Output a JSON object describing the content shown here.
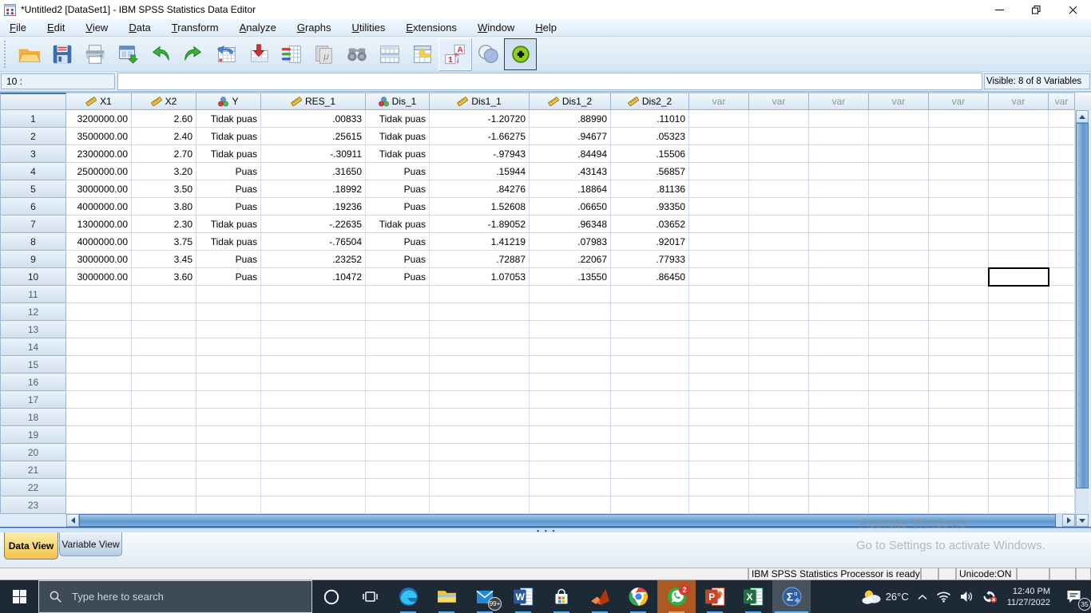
{
  "window": {
    "title": "*Untitled2 [DataSet1] - IBM SPSS Statistics Data Editor",
    "controls": {
      "minimize": "minimize",
      "restore": "restore",
      "close": "close"
    }
  },
  "menu": {
    "items": [
      {
        "label": "File",
        "underline": "F"
      },
      {
        "label": "Edit",
        "underline": "E"
      },
      {
        "label": "View",
        "underline": "V"
      },
      {
        "label": "Data",
        "underline": "D"
      },
      {
        "label": "Transform",
        "underline": "T"
      },
      {
        "label": "Analyze",
        "underline": "A"
      },
      {
        "label": "Graphs",
        "underline": "G"
      },
      {
        "label": "Utilities",
        "underline": "U"
      },
      {
        "label": "Extensions",
        "underline": "E"
      },
      {
        "label": "Window",
        "underline": "W"
      },
      {
        "label": "Help",
        "underline": "H"
      }
    ]
  },
  "toolbar": {
    "icons": [
      {
        "name": "open-data",
        "state": "normal"
      },
      {
        "name": "save",
        "state": "normal"
      },
      {
        "name": "print",
        "state": "normal"
      },
      {
        "name": "recall-dialogs",
        "state": "normal"
      },
      {
        "name": "undo",
        "state": "normal"
      },
      {
        "name": "redo",
        "state": "normal"
      },
      {
        "name": "goto-case",
        "state": "normal"
      },
      {
        "name": "goto-variable",
        "state": "normal"
      },
      {
        "name": "variables",
        "state": "normal"
      },
      {
        "name": "descriptives",
        "state": "disabled"
      },
      {
        "name": "find",
        "state": "disabled"
      },
      {
        "name": "insert-cases",
        "state": "normal"
      },
      {
        "name": "select-cases",
        "state": "normal"
      },
      {
        "name": "value-labels",
        "state": "raised"
      },
      {
        "name": "use-variable-sets",
        "state": "normal"
      },
      {
        "name": "show-all-variables",
        "state": "pressed"
      }
    ]
  },
  "cellbar": {
    "cell_reference": "10 :",
    "edit_value": "",
    "visible_info": "Visible: 8 of 8 Variables"
  },
  "grid": {
    "columns": [
      {
        "label": "X1",
        "type": "scale"
      },
      {
        "label": "X2",
        "type": "scale"
      },
      {
        "label": "Y",
        "type": "nominal"
      },
      {
        "label": "RES_1",
        "type": "scale"
      },
      {
        "label": "Dis_1",
        "type": "nominal"
      },
      {
        "label": "Dis1_1",
        "type": "scale"
      },
      {
        "label": "Dis1_2",
        "type": "scale"
      },
      {
        "label": "Dis2_2",
        "type": "scale"
      },
      {
        "label": "var",
        "type": "empty"
      },
      {
        "label": "var",
        "type": "empty"
      },
      {
        "label": "var",
        "type": "empty"
      },
      {
        "label": "var",
        "type": "empty"
      },
      {
        "label": "var",
        "type": "empty"
      },
      {
        "label": "var",
        "type": "empty"
      },
      {
        "label": "var",
        "type": "empty"
      }
    ],
    "total_rows": 23,
    "rows": [
      {
        "n": "1",
        "values": [
          "3200000.00",
          "2.60",
          "Tidak puas",
          ".00833",
          "Tidak puas",
          "-1.20720",
          ".88990",
          ".11010"
        ]
      },
      {
        "n": "2",
        "values": [
          "3500000.00",
          "2.40",
          "Tidak puas",
          ".25615",
          "Tidak puas",
          "-1.66275",
          ".94677",
          ".05323"
        ]
      },
      {
        "n": "3",
        "values": [
          "2300000.00",
          "2.70",
          "Tidak puas",
          "-.30911",
          "Tidak puas",
          "-.97943",
          ".84494",
          ".15506"
        ]
      },
      {
        "n": "4",
        "values": [
          "2500000.00",
          "3.20",
          "Puas",
          ".31650",
          "Puas",
          ".15944",
          ".43143",
          ".56857"
        ]
      },
      {
        "n": "5",
        "values": [
          "3000000.00",
          "3.50",
          "Puas",
          ".18992",
          "Puas",
          ".84276",
          ".18864",
          ".81136"
        ]
      },
      {
        "n": "6",
        "values": [
          "4000000.00",
          "3.80",
          "Puas",
          ".19236",
          "Puas",
          "1.52608",
          ".06650",
          ".93350"
        ]
      },
      {
        "n": "7",
        "values": [
          "1300000.00",
          "2.30",
          "Tidak puas",
          "-.22635",
          "Tidak puas",
          "-1.89052",
          ".96348",
          ".03652"
        ]
      },
      {
        "n": "8",
        "values": [
          "4000000.00",
          "3.75",
          "Tidak puas",
          "-.76504",
          "Puas",
          "1.41219",
          ".07983",
          ".92017"
        ]
      },
      {
        "n": "9",
        "values": [
          "3000000.00",
          "3.45",
          "Puas",
          ".23252",
          "Puas",
          ".72887",
          ".22067",
          ".77933"
        ]
      },
      {
        "n": "10",
        "values": [
          "3000000.00",
          "3.60",
          "Puas",
          ".10472",
          "Puas",
          "1.07053",
          ".13550",
          ".86450"
        ]
      }
    ],
    "selected_cell": {
      "row": 10,
      "column_index": 13
    }
  },
  "tabs": {
    "data_view": "Data View",
    "variable_view": "Variable View"
  },
  "statusbar": {
    "message": "IBM SPSS Statistics Processor is ready",
    "unicode": "Unicode:ON"
  },
  "watermark": {
    "line1": "Activate Windows",
    "line2": "Go to Settings to activate Windows."
  },
  "taskbar": {
    "search_placeholder": "Type here to search",
    "apps": [
      {
        "name": "edge"
      },
      {
        "name": "file-explorer"
      },
      {
        "name": "mail",
        "badge": "99+"
      },
      {
        "name": "word"
      },
      {
        "name": "store"
      },
      {
        "name": "matlab"
      },
      {
        "name": "chrome"
      },
      {
        "name": "whatsapp",
        "badge": "2",
        "highlight": "orange"
      },
      {
        "name": "powerpoint"
      },
      {
        "name": "excel"
      },
      {
        "name": "spss",
        "active": true
      }
    ],
    "tray": {
      "temperature": "26°C",
      "time": "12:40 PM",
      "date": "11/27/2022",
      "notification_count": "35"
    }
  }
}
